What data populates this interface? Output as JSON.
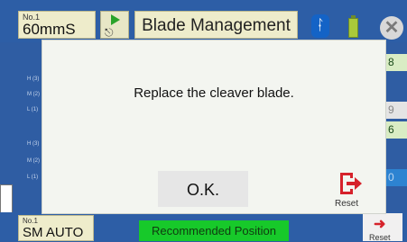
{
  "header": {
    "mode_number": "No.1",
    "mode_value": "60mmS",
    "title": "Blade Management"
  },
  "side_labels_left": [
    "H (3)",
    "M (2)",
    "L (1)",
    "H (3)",
    "M (2)",
    "L (1)"
  ],
  "side_values_right": [
    "8",
    "9",
    "6",
    "0"
  ],
  "footer": {
    "mode_number": "No.1",
    "mode_value": "SM AUTO",
    "status": "Recommended Position",
    "reset_label": "Reset"
  },
  "dialog": {
    "message": "Replace the cleaver blade.",
    "ok_label": "O.K.",
    "reset_label": "Reset"
  },
  "colors": {
    "background": "#2f5da3",
    "accent_red": "#d6222b",
    "status_green": "#17c92a"
  }
}
